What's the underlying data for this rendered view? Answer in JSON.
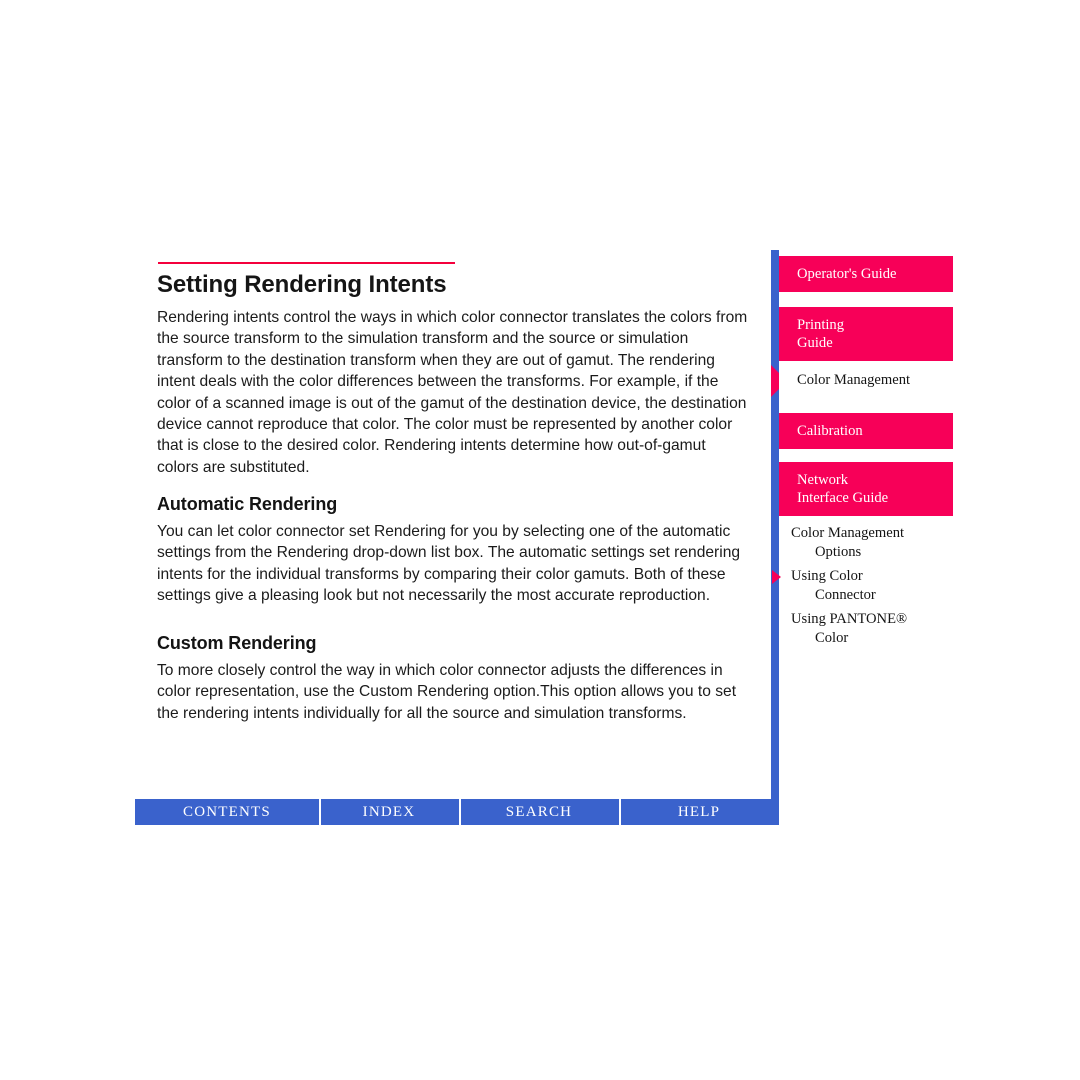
{
  "page": {
    "title": "Setting Rendering Intents",
    "intro_paragraph": "Rendering intents control the ways in which color connector translates the colors from the source transform to the simulation transform and the source or simulation transform to the destination transform when they are out of gamut. The rendering intent deals with the color differences between the transforms. For example, if the color of a scanned image is out of the gamut of the destination device, the destination device cannot reproduce that color. The color must be represented by another color that is close to the desired color. Rendering intents determine how out-of-gamut colors are substituted.",
    "sections": [
      {
        "heading": "Automatic Rendering",
        "paragraph": "You can let color connector set Rendering for you by selecting one of the automatic settings from the Rendering drop-down list box. The automatic settings set rendering intents for the individual transforms by comparing their color gamuts. Both of these settings give a pleasing look but not necessarily the most accurate reproduction."
      },
      {
        "heading": "Custom Rendering",
        "paragraph": "To more closely control the way in which color connector adjusts the differences in color representation, use the Custom Rendering option.This option allows you to set the rendering intents individually for all the source and simulation transforms."
      }
    ]
  },
  "sidebar": {
    "tabs": [
      {
        "label": "Operator's Guide",
        "selected": false
      },
      {
        "label": "Printing Guide",
        "line1": "Printing",
        "line2": "Guide",
        "selected": false
      },
      {
        "label": "Color Management",
        "selected": true
      },
      {
        "label": "Calibration",
        "selected": false
      },
      {
        "label": "Network Interface Guide",
        "line1": "Network",
        "line2": "Interface Guide",
        "selected": false
      }
    ],
    "sub_items": [
      {
        "line1": "Color Management",
        "line2": "Options",
        "selected": false
      },
      {
        "line1": "Using Color",
        "line2": "Connector",
        "selected": true
      },
      {
        "line1": "Using PANTONE®",
        "line2": "Color",
        "selected": false
      }
    ]
  },
  "footer": {
    "items": [
      {
        "label": "CONTENTS"
      },
      {
        "label": "INDEX"
      },
      {
        "label": "SEARCH"
      },
      {
        "label": "HELP"
      }
    ]
  },
  "colors": {
    "accent_pink": "#f70058",
    "rule_red": "#f4003c",
    "nav_blue": "#3a62cc",
    "text": "#1b1b1b",
    "page_background": "#ffffff"
  }
}
